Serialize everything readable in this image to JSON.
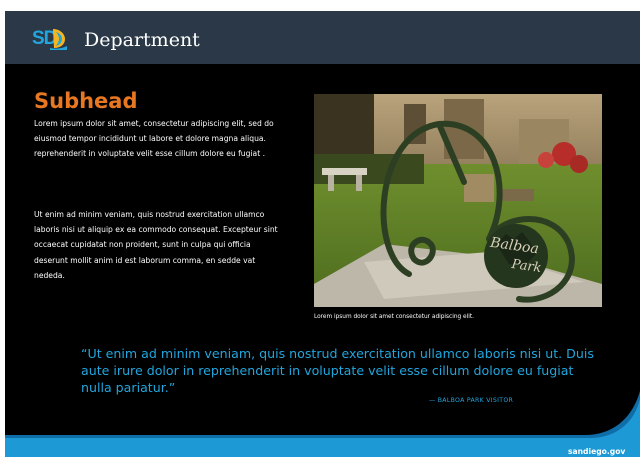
{
  "header": {
    "logo_text": "SD",
    "title": "Department"
  },
  "main": {
    "subhead": "Subhead",
    "paragraphs": [
      "Lorem ipsum dolor sit amet, consectetur adipiscing elit, sed do eiusmod tempor incididunt ut labore et dolore magna aliqua. reprehenderit in voluptate velit esse cillum dolore eu fugiat .",
      "Ut enim ad minim veniam, quis nostrud exercitation ullamco laboris nisi ut aliquip ex ea commodo consequat. Excepteur sint occaecat cupidatat non proident, sunt in culpa qui officia deserunt mollit anim id est laborum comma, en sedde vat nededa."
    ],
    "photo": {
      "sign_line1": "Balboa",
      "sign_line2": "Park",
      "caption": "Lorem ipsum dolor sit amet consectetur adipiscing elit."
    },
    "quote": {
      "text": "“Ut enim ad minim veniam, quis nostrud exercitation ullamco laboris nisi ut. Duis aute irure dolor in reprehenderit in voluptate velit esse cillum dolore eu fugiat nulla pariatur.”",
      "attribution": "— BALBOA PARK VISITOR"
    }
  },
  "footer": {
    "site": "sandiego.gov"
  },
  "colors": {
    "header_bg": "#2a3847",
    "accent_orange": "#e87722",
    "accent_blue": "#21a6de",
    "background": "#000000"
  },
  "icons": {
    "logo_mark": "sun-wave-icon"
  }
}
